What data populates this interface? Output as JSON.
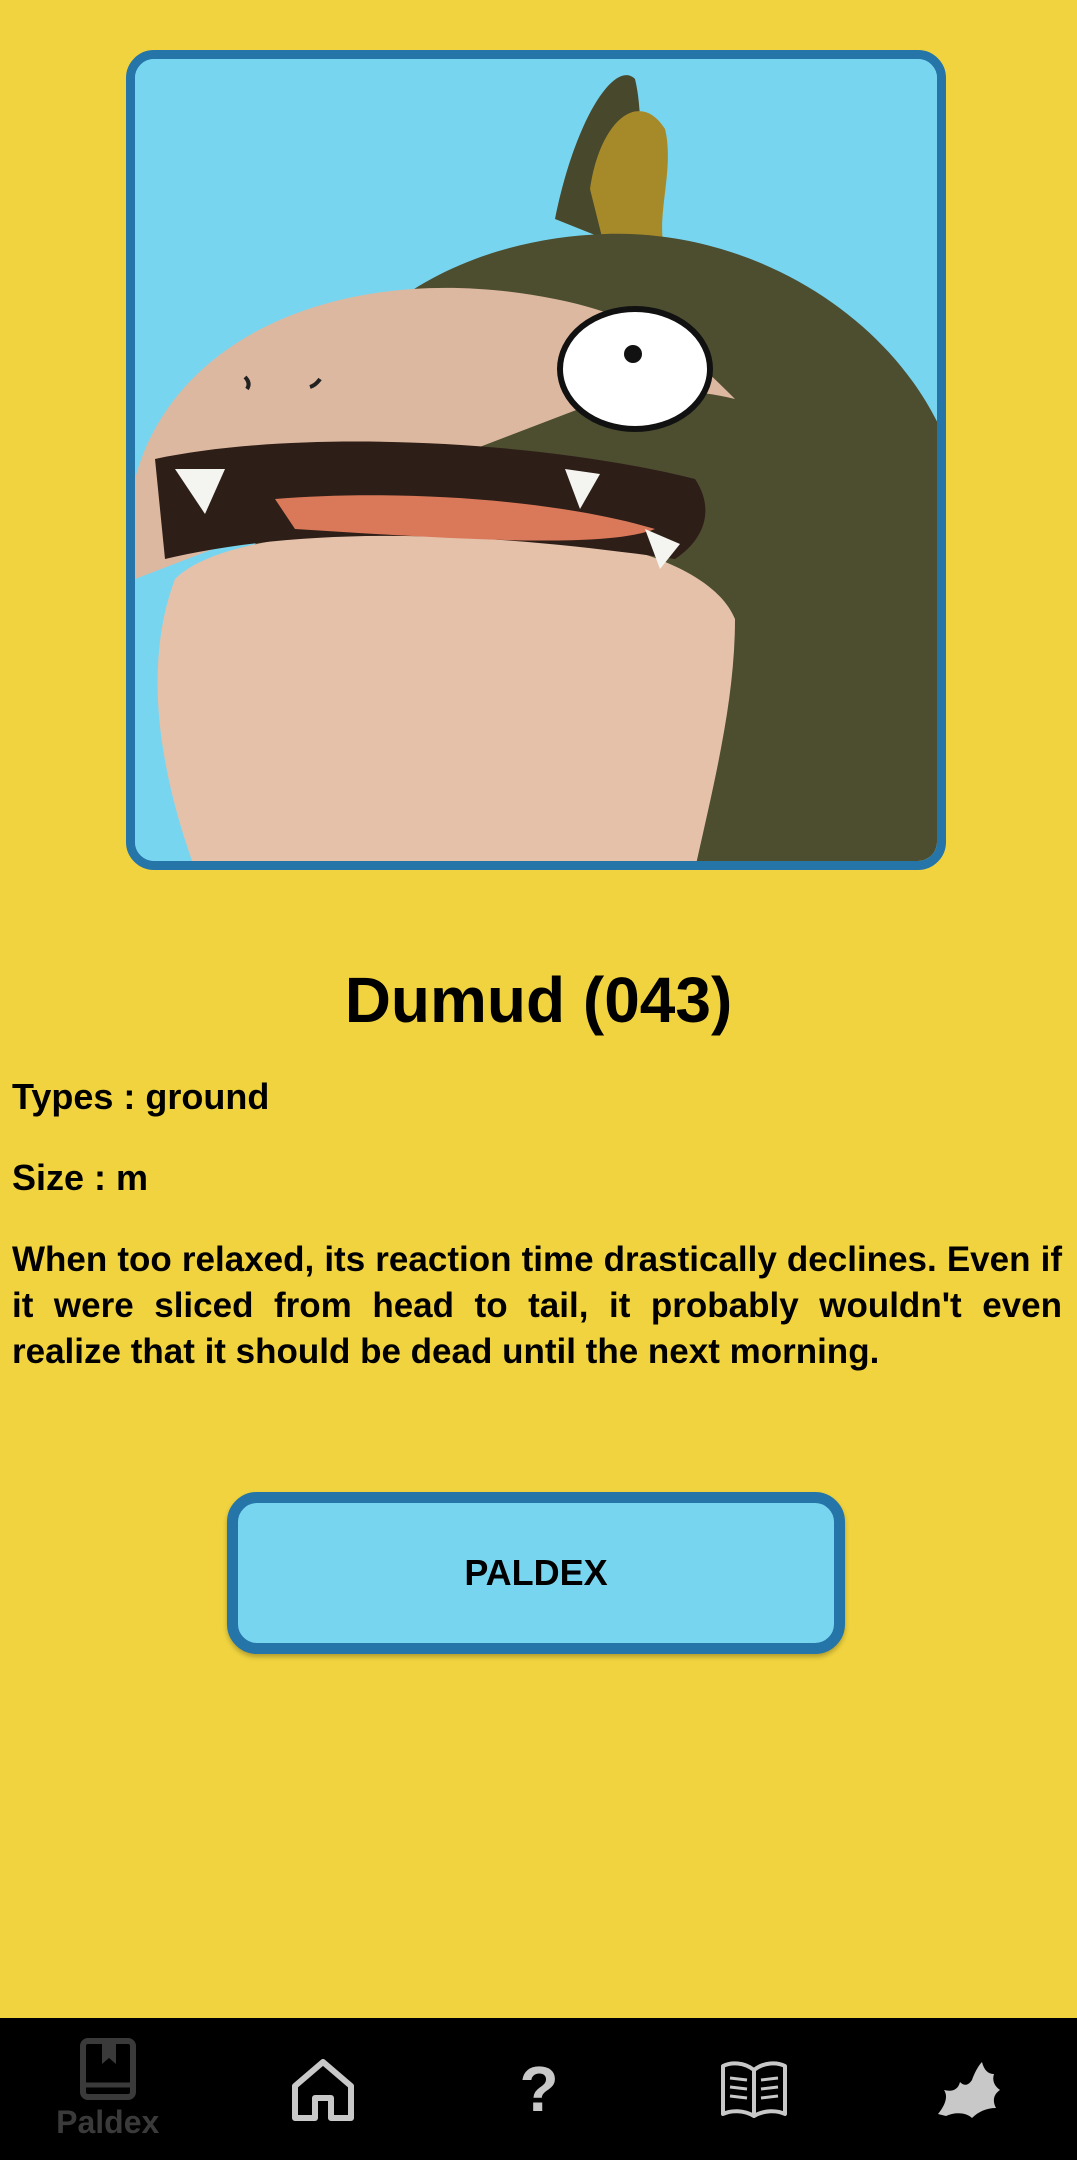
{
  "pokemon": {
    "title": "Dumud (043)",
    "types_text": "Types : ground",
    "size_text": "Size : m",
    "description": "When too relaxed, its reaction time drastically declines. Even if it were sliced from head to tail, it probably wouldn't even realize that it should be dead until the next morning."
  },
  "button": {
    "label": "PALDEX"
  },
  "nav": {
    "items": [
      {
        "icon": "book-bookmark-icon",
        "label": "Paldex"
      },
      {
        "icon": "home-icon"
      },
      {
        "icon": "question-icon"
      },
      {
        "icon": "open-book-icon"
      },
      {
        "icon": "leaf-icon"
      }
    ]
  },
  "colors": {
    "background": "#f0d33f",
    "frame_border": "#2675a8",
    "frame_fill": "#78d5f0",
    "nav_background": "#000000",
    "nav_icon_active": "#3a3a3a",
    "nav_icon": "#c8c8c8"
  }
}
